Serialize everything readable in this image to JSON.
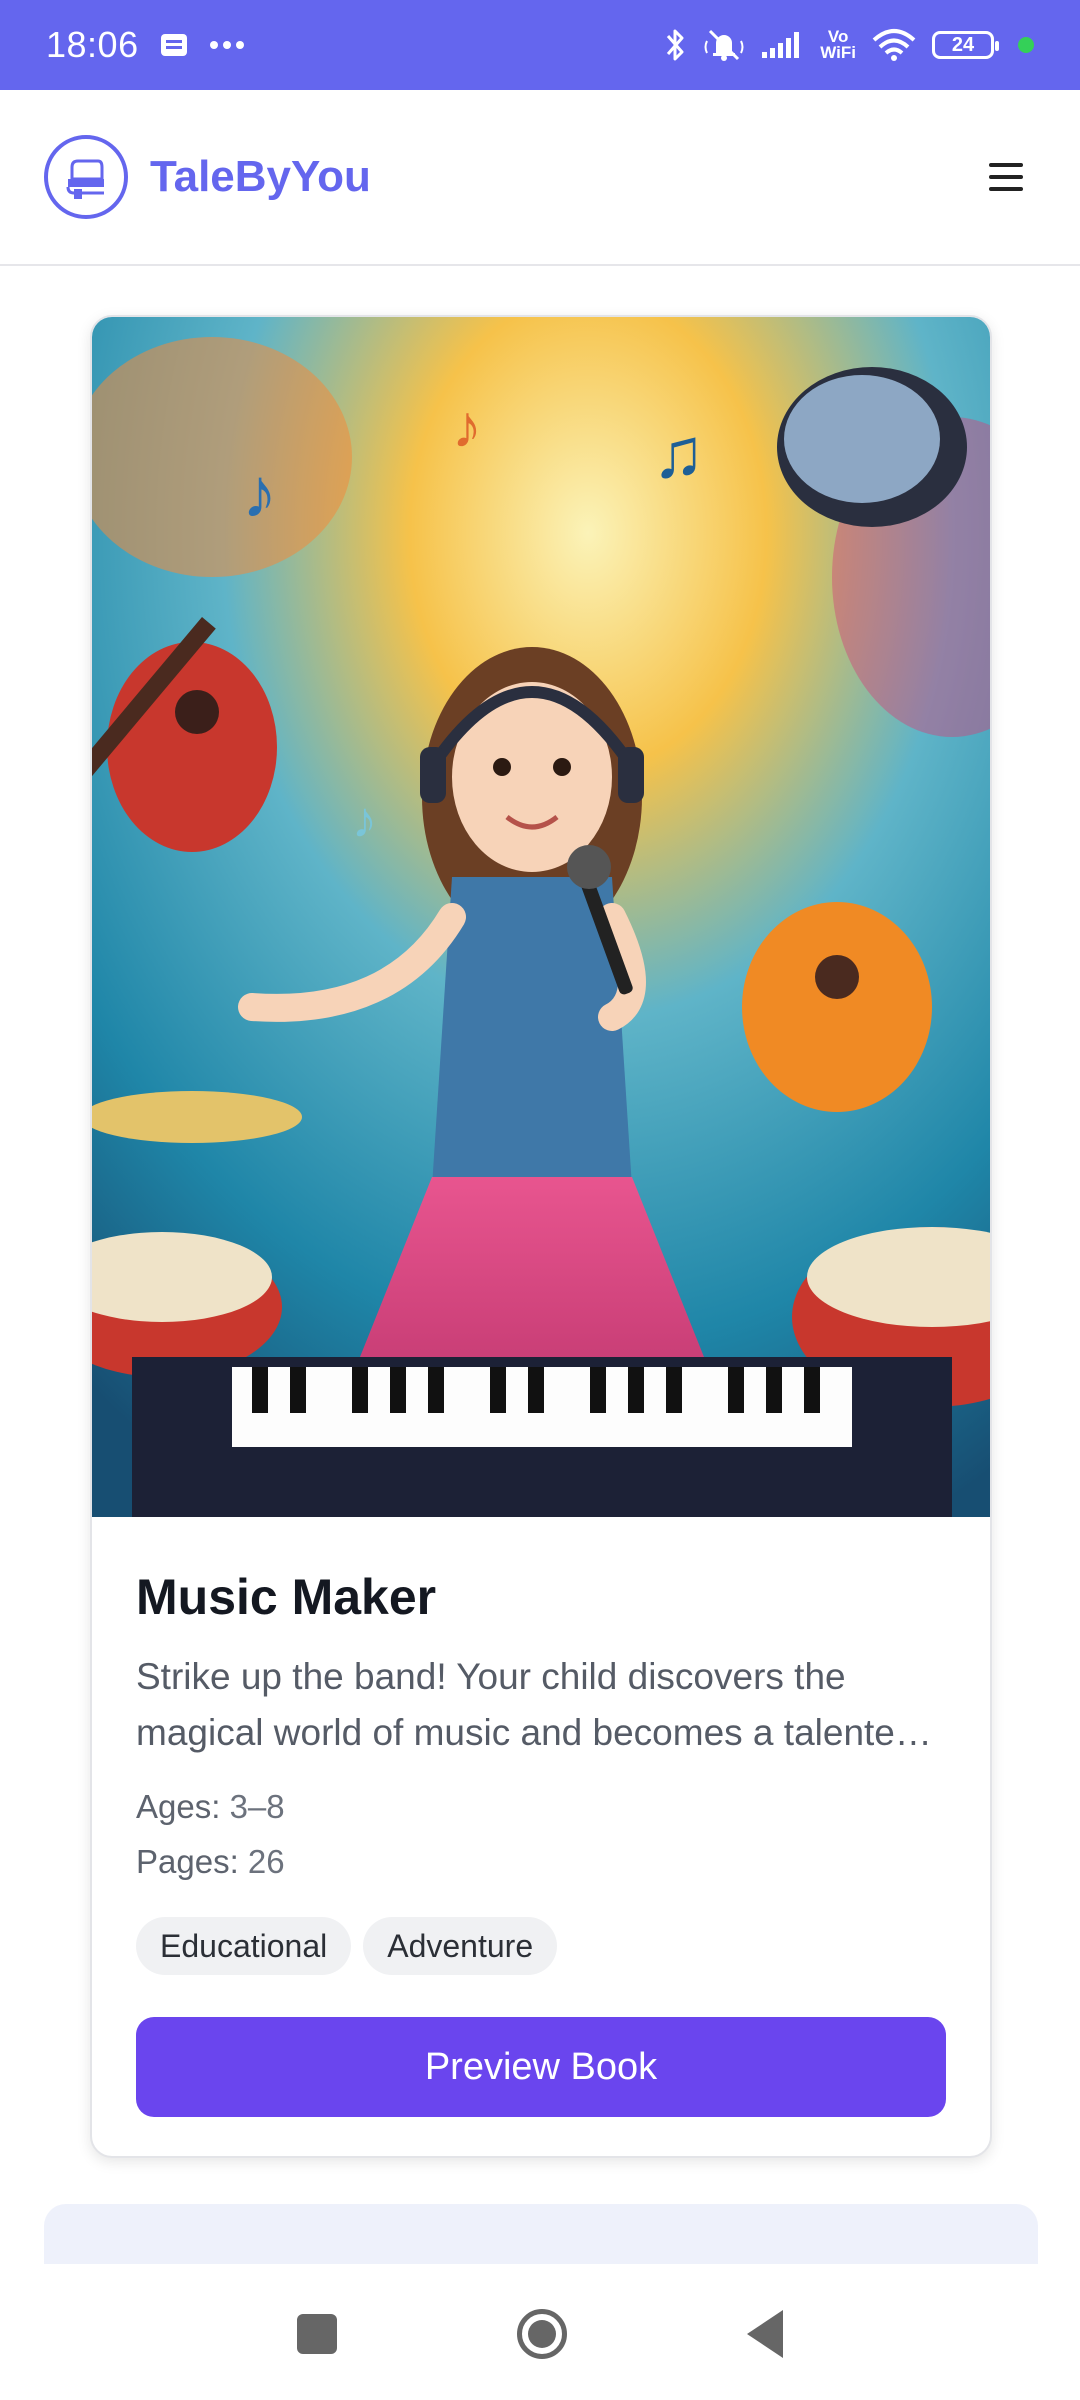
{
  "status_bar": {
    "time": "18:06",
    "notification_icons": [
      "message-icon",
      "more-dots-icon"
    ],
    "system_icons": [
      "bluetooth-icon",
      "muted-bell-icon",
      "signal-icon",
      "vowifi-icon",
      "wifi-icon",
      "battery-icon"
    ],
    "vowifi_text": "Vo\nWiFi",
    "battery_level": "24"
  },
  "header": {
    "brand": "TaleByYou",
    "logo_icon": "book-logo-icon",
    "menu_icon": "hamburger-menu-icon"
  },
  "book": {
    "title": "Music Maker",
    "description": "Strike up the band! Your child discovers the magical world of music and becomes a talented musician…",
    "ages_label": "Ages:",
    "ages_value": "3–8",
    "pages_label": "Pages:",
    "pages_value": "26",
    "tags": [
      "Educational",
      "Adventure"
    ],
    "preview_label": "Preview Book"
  },
  "colors": {
    "brand": "#6466EE",
    "button": "#6A45EE"
  },
  "nav": {
    "icons": [
      "recents-icon",
      "home-icon",
      "back-icon"
    ]
  }
}
